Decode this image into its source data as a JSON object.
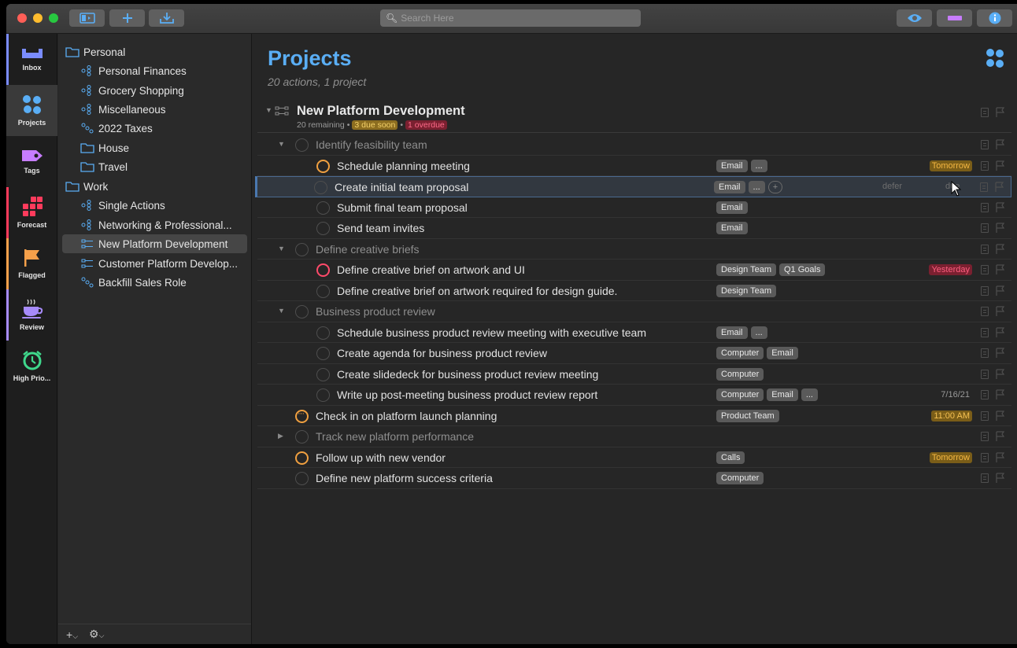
{
  "toolbar": {
    "search_placeholder": "Search Here"
  },
  "perspectives": [
    {
      "label": "Inbox",
      "icon": "inbox-icon"
    },
    {
      "label": "Projects",
      "icon": "projects-icon"
    },
    {
      "label": "Tags",
      "icon": "tag-icon"
    },
    {
      "label": "Forecast",
      "icon": "forecast-icon"
    },
    {
      "label": "Flagged",
      "icon": "flag-icon"
    },
    {
      "label": "Review",
      "icon": "coffee-icon"
    },
    {
      "label": "High Prio...",
      "icon": "alarm-clock-icon"
    }
  ],
  "sidebar": {
    "items": [
      {
        "label": "Personal",
        "icon": "folder-icon",
        "level": 0
      },
      {
        "label": "Personal Finances",
        "icon": "single-actions-icon",
        "level": 1
      },
      {
        "label": "Grocery Shopping",
        "icon": "single-actions-icon",
        "level": 1
      },
      {
        "label": "Miscellaneous",
        "icon": "single-actions-icon",
        "level": 1
      },
      {
        "label": "2022 Taxes",
        "icon": "sequential-icon",
        "level": 1
      },
      {
        "label": "House",
        "icon": "folder-icon",
        "level": 1
      },
      {
        "label": "Travel",
        "icon": "folder-icon",
        "level": 1
      },
      {
        "label": "Work",
        "icon": "folder-icon",
        "level": 0
      },
      {
        "label": "Single Actions",
        "icon": "single-actions-icon",
        "level": 1
      },
      {
        "label": "Networking & Professional...",
        "icon": "single-actions-icon",
        "level": 1
      },
      {
        "label": "New Platform Development",
        "icon": "parallel-icon",
        "level": 1
      },
      {
        "label": "Customer Platform Develop...",
        "icon": "parallel-icon",
        "level": 1
      },
      {
        "label": "Backfill Sales Role",
        "icon": "sequential-icon",
        "level": 1
      }
    ],
    "footer_add": "+",
    "footer_gear": "⚙"
  },
  "main": {
    "title": "Projects",
    "subtitle": "20 actions, 1 project",
    "project": {
      "title": "New Platform Development",
      "remaining": "20 remaining",
      "due_soon": "3 due soon",
      "overdue": "1 overdue",
      "separator": "•"
    },
    "rows": [
      {
        "text": "Identify feasibility team",
        "group": true,
        "indent": 0,
        "disclosure": "▼",
        "circle": "",
        "tags": [],
        "date": "",
        "date_style": ""
      },
      {
        "text": "Schedule planning meeting",
        "group": false,
        "indent": 1,
        "circle": "orange",
        "tags": [
          "Email",
          "..."
        ],
        "date": "Tomorrow",
        "date_style": "tomorrow"
      },
      {
        "text": "Create initial team proposal",
        "group": false,
        "indent": 1,
        "circle": "",
        "tags": [
          "Email",
          "...",
          "+"
        ],
        "date": "",
        "date_style": "",
        "selected": true,
        "defer": "defer",
        "due": "due"
      },
      {
        "text": "Submit final team proposal",
        "group": false,
        "indent": 1,
        "circle": "",
        "tags": [
          "Email"
        ],
        "date": "",
        "date_style": ""
      },
      {
        "text": "Send team invites",
        "group": false,
        "indent": 1,
        "circle": "",
        "tags": [
          "Email"
        ],
        "date": "",
        "date_style": ""
      },
      {
        "text": "Define creative briefs",
        "group": true,
        "indent": 0,
        "disclosure": "▼",
        "circle": "",
        "tags": [],
        "date": "",
        "date_style": ""
      },
      {
        "text": "Define creative brief on artwork and UI",
        "group": false,
        "indent": 1,
        "circle": "red",
        "tags": [
          "Design Team",
          "Q1 Goals"
        ],
        "date": "Yesterday",
        "date_style": "yesterday"
      },
      {
        "text": "Define creative brief on artwork required for design guide.",
        "group": false,
        "indent": 1,
        "circle": "",
        "tags": [
          "Design Team"
        ],
        "date": "",
        "date_style": ""
      },
      {
        "text": "Business product review",
        "group": true,
        "indent": 0,
        "disclosure": "▼",
        "circle": "",
        "tags": [],
        "date": "",
        "date_style": ""
      },
      {
        "text": "Schedule business product review meeting with executive team",
        "group": false,
        "indent": 1,
        "circle": "",
        "tags": [
          "Email",
          "..."
        ],
        "date": "",
        "date_style": ""
      },
      {
        "text": "Create agenda for business product review",
        "group": false,
        "indent": 1,
        "circle": "",
        "tags": [
          "Computer",
          "Email"
        ],
        "date": "",
        "date_style": ""
      },
      {
        "text": "Create slidedeck for business product review meeting",
        "group": false,
        "indent": 1,
        "circle": "",
        "tags": [
          "Computer"
        ],
        "date": "",
        "date_style": ""
      },
      {
        "text": "Write up post-meeting business product review report",
        "group": false,
        "indent": 1,
        "circle": "",
        "tags": [
          "Computer",
          "Email",
          "..."
        ],
        "date": "7/16/21",
        "date_style": "plain"
      },
      {
        "text": "Check in on platform launch planning",
        "group": false,
        "indent": 0,
        "circle": "orange-dots",
        "tags": [
          "Product Team"
        ],
        "date": "11:00 AM",
        "date_style": "time"
      },
      {
        "text": "Track new platform performance",
        "group": true,
        "indent": 0,
        "disclosure": "▶",
        "circle": "",
        "tags": [],
        "date": "",
        "date_style": ""
      },
      {
        "text": "Follow up with new vendor",
        "group": false,
        "indent": 0,
        "circle": "orange",
        "tags": [
          "Calls"
        ],
        "date": "Tomorrow",
        "date_style": "tomorrow"
      },
      {
        "text": "Define new platform success criteria",
        "group": false,
        "indent": 0,
        "circle": "",
        "tags": [
          "Computer"
        ],
        "date": "",
        "date_style": ""
      }
    ]
  },
  "colors": {
    "accent": "#5aaef5",
    "inbox": "#7a8cff",
    "projects": "#5aaef5",
    "tags": "#c77dff",
    "forecast": "#ff3b5c",
    "flagged": "#f5a04a",
    "review": "#a78bfa",
    "high_priority": "#3fd88c"
  }
}
